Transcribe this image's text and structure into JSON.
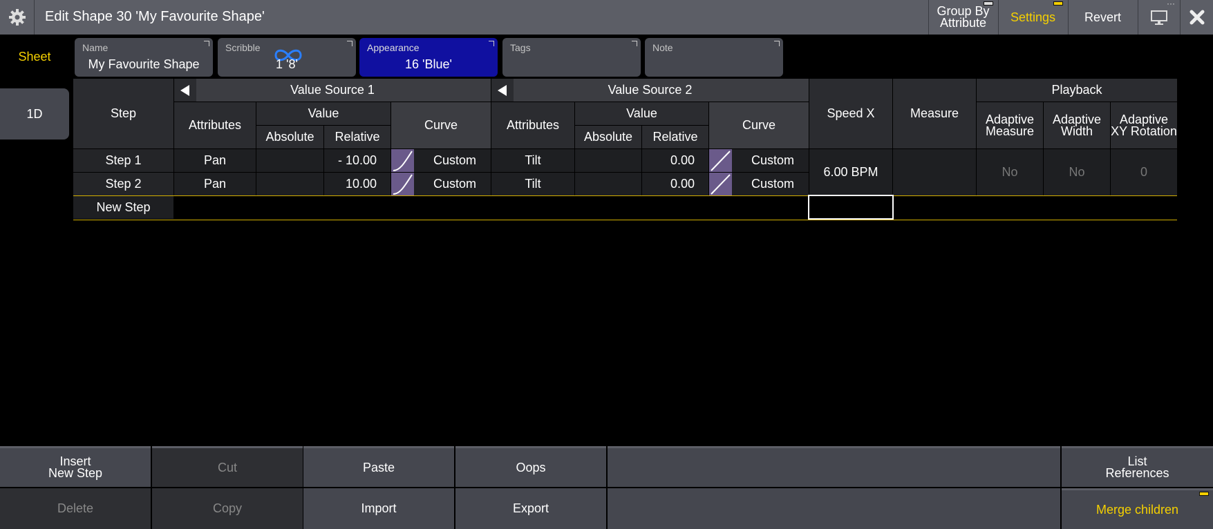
{
  "titlebar": {
    "title": "Edit Shape 30 'My Favourite Shape'",
    "group_by": "Group By\nAttribute",
    "settings": "Settings",
    "revert": "Revert",
    "icons": [
      "gear-icon",
      "display-icon",
      "close-icon"
    ]
  },
  "sidebar": {
    "sheet": "Sheet",
    "tab_1d": "1D"
  },
  "fields": {
    "name": {
      "label": "Name",
      "value": "My Favourite Shape"
    },
    "scribble": {
      "label": "Scribble",
      "value": "1 '8'"
    },
    "appearance": {
      "label": "Appearance",
      "value": "16 'Blue'",
      "color": "#1010a0"
    },
    "tags": {
      "label": "Tags",
      "value": ""
    },
    "note": {
      "label": "Note",
      "value": ""
    }
  },
  "table": {
    "headers": {
      "step": "Step",
      "vs1": "Value Source 1",
      "vs2": "Value Source 2",
      "attributes": "Attributes",
      "value": "Value",
      "absolute": "Absolute",
      "relative": "Relative",
      "curve": "Curve",
      "speed_x": "Speed X",
      "measure": "Measure",
      "playback": "Playback",
      "adaptive_measure": "Adaptive\nMeasure",
      "adaptive_width": "Adaptive\nWidth",
      "adaptive_xy": "Adaptive\nXY Rotation"
    },
    "rows": [
      {
        "step": "Step 1",
        "attr1": "Pan",
        "rel1": "- 10.00",
        "curve1": "Custom",
        "attr2": "Tilt",
        "rel2": "0.00",
        "curve2": "Custom"
      },
      {
        "step": "Step 2",
        "attr1": "Pan",
        "rel1": "10.00",
        "curve1": "Custom",
        "attr2": "Tilt",
        "rel2": "0.00",
        "curve2": "Custom"
      }
    ],
    "speed": "6.00 BPM",
    "adaptive_measure": "No",
    "adaptive_width": "No",
    "adaptive_xy": "0",
    "new_step": "New Step"
  },
  "bottombar": {
    "insert": "Insert\nNew Step",
    "cut": "Cut",
    "paste": "Paste",
    "oops": "Oops",
    "list_refs": "List\nReferences",
    "delete": "Delete",
    "copy": "Copy",
    "import": "Import",
    "export": "Export",
    "merge": "Merge children"
  },
  "colors": {
    "accent_yellow": "#f5d000",
    "curve_purple": "#6a5a8a"
  }
}
